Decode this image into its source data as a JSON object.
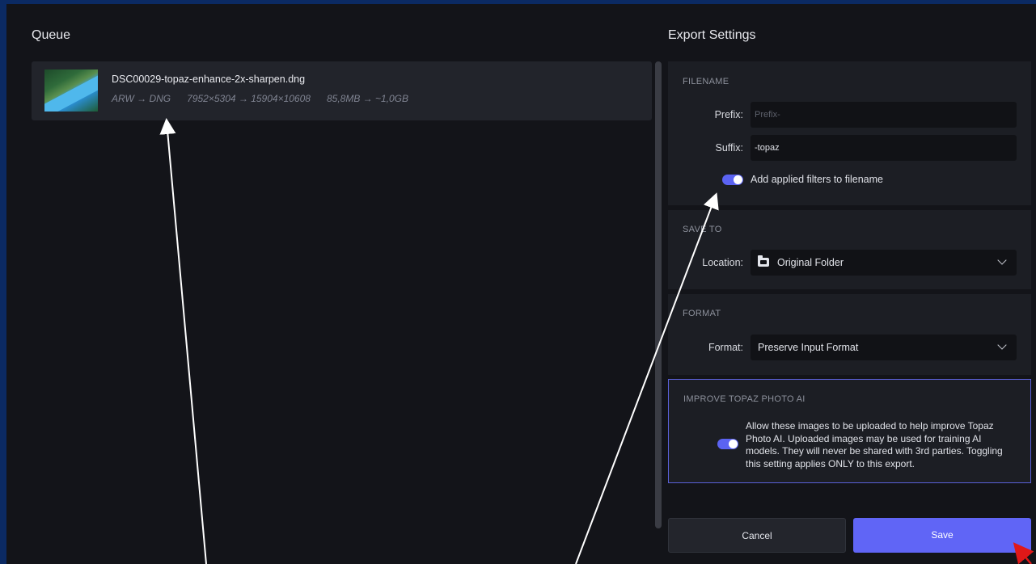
{
  "queue": {
    "title": "Queue",
    "item": {
      "filename": "DSC00029-topaz-enhance-2x-sharpen.dng",
      "format": "ARW → DNG",
      "dimensions": "7952×5304 → 15904×10608",
      "size": "85,8MB → ~1,0GB"
    }
  },
  "export": {
    "title": "Export Settings",
    "filename_section": {
      "label": "FILENAME",
      "prefix_label": "Prefix:",
      "prefix_placeholder": "Prefix-",
      "suffix_label": "Suffix:",
      "suffix_value": "-topaz",
      "add_filters_label": "Add applied filters to filename",
      "add_filters_on": true
    },
    "save_to_section": {
      "label": "SAVE TO",
      "location_label": "Location:",
      "location_value": "Original Folder"
    },
    "format_section": {
      "label": "FORMAT",
      "format_label": "Format:",
      "format_value": "Preserve Input Format"
    },
    "improve_section": {
      "label": "IMPROVE TOPAZ PHOTO AI",
      "text": "Allow these images to be uploaded to help improve Topaz Photo AI. Uploaded images may be used for training AI models. They will never be shared with 3rd parties. Toggling this setting applies ONLY to this export.",
      "enabled": true
    },
    "cancel_label": "Cancel",
    "save_label": "Save"
  },
  "colors": {
    "accent": "#6065f6",
    "background": "#131419",
    "panel": "#1c1e24",
    "outer": "#0b2a63"
  }
}
